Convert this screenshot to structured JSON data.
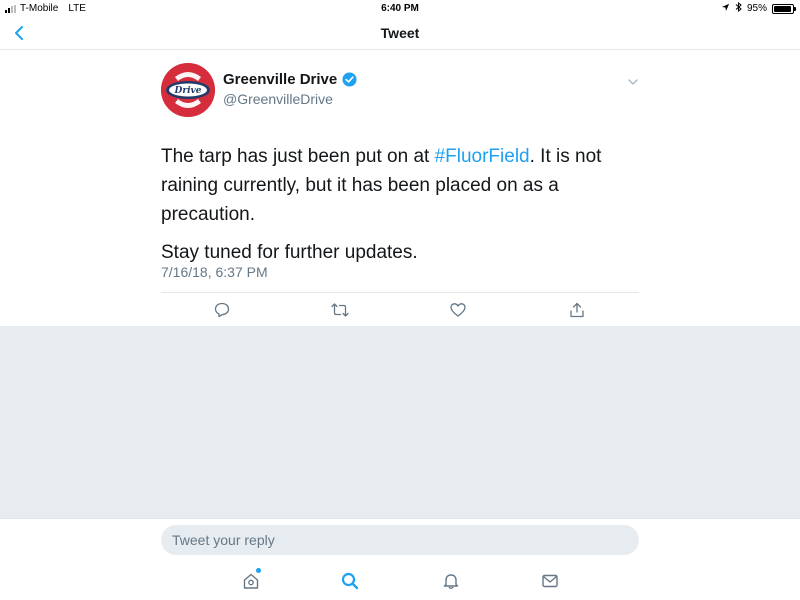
{
  "status_bar": {
    "carrier": "T-Mobile",
    "network": "LTE",
    "time": "6:40 PM",
    "battery": "95%",
    "battery_level": 0.95
  },
  "nav": {
    "title": "Tweet"
  },
  "tweet": {
    "author": {
      "name": "Greenville Drive",
      "handle": "@GreenvilleDrive",
      "verified": true,
      "avatar_color": "#d62d3c",
      "avatar_logo_text": "Drive"
    },
    "text_part1": "The tarp has just been put on at ",
    "hashtag": "#FluorField",
    "text_part2": ". It is not raining currently, but it has been placed on as a precaution.",
    "text_para2": "Stay tuned for further updates.",
    "timestamp": "7/16/18, 6:37 PM",
    "actions": [
      "reply-icon",
      "retweet-icon",
      "like-icon",
      "share-icon"
    ]
  },
  "reply": {
    "placeholder": "Tweet your reply"
  },
  "tab_bar": {
    "tabs": [
      "home-icon",
      "search-icon",
      "notifications-icon",
      "messages-icon"
    ],
    "active": "search-icon"
  },
  "colors": {
    "accent": "#1da1f2",
    "muted": "#657786",
    "text": "#14171a",
    "background_grey": "#e6ecf0",
    "border": "#e1e8ed"
  }
}
